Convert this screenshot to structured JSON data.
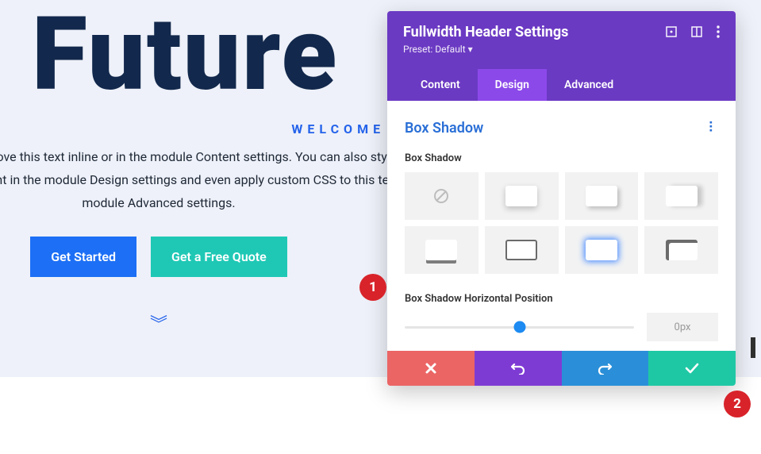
{
  "hero": {
    "title": "Future",
    "subtitle_w": "W",
    "subtitle_rest": "elcome to Divi",
    "desc_line": "es here. Edit or remove this text inline or in the module Content settings. You can also style every aspect of this content in the module Design settings and even apply custom CSS to this text in the module Advanced settings.",
    "btn_primary": "Get Started",
    "btn_secondary": "Get a Free Quote"
  },
  "panel": {
    "title": "Fullwidth Header Settings",
    "preset": "Preset: Default ▾",
    "tabs": {
      "content": "Content",
      "design": "Design",
      "advanced": "Advanced"
    },
    "section": {
      "title": "Box Shadow",
      "label_presets": "Box Shadow",
      "label_hpos": "Box Shadow Horizontal Position",
      "hpos_value": "0px"
    }
  },
  "markers": {
    "m1": "1",
    "m2": "2"
  }
}
